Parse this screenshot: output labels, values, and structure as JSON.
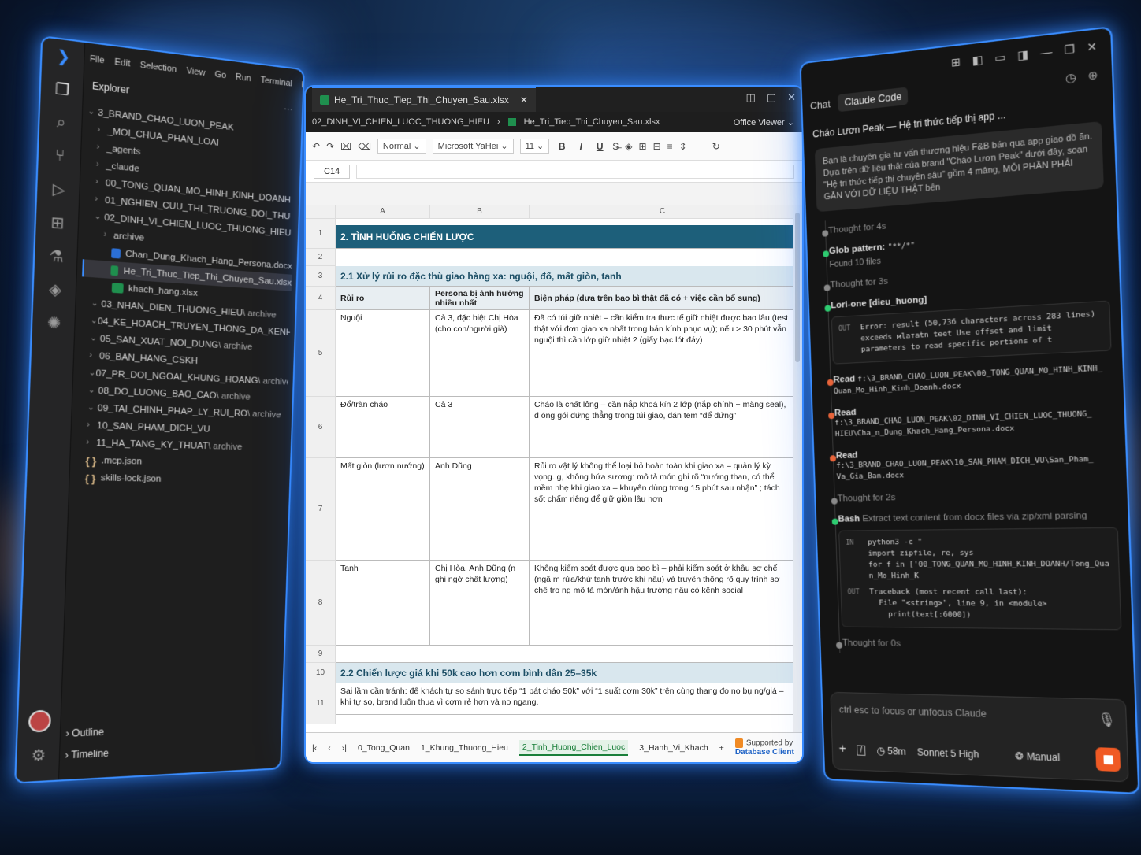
{
  "vscode": {
    "menu": [
      "File",
      "Edit",
      "Selection",
      "View",
      "Go",
      "Run",
      "Terminal",
      "Help"
    ],
    "explorer_title": "Explorer",
    "root": "3_BRAND_CHAO_LUON_PEAK",
    "tree": [
      {
        "chev": "›",
        "name": "_MOI_CHUA_PHAN_LOAI",
        "suffix": "",
        "type": "folder",
        "indent": 1
      },
      {
        "chev": "›",
        "name": "_agents",
        "suffix": "",
        "type": "folder",
        "indent": 1
      },
      {
        "chev": "›",
        "name": "_claude",
        "suffix": "",
        "type": "folder",
        "indent": 1
      },
      {
        "chev": "›",
        "name": "00_TONG_QUAN_MO_HINH_KINH_DOANH",
        "suffix": "",
        "type": "folder",
        "indent": 1
      },
      {
        "chev": "›",
        "name": "01_NGHIEN_CUU_THI_TRUONG_DOI_THU",
        "suffix": "",
        "type": "folder",
        "indent": 1
      },
      {
        "chev": "⌄",
        "name": "02_DINH_VI_CHIEN_LUOC_THUONG_HIEU",
        "suffix": "",
        "type": "folder",
        "indent": 1
      },
      {
        "chev": "›",
        "name": "archive",
        "suffix": "",
        "type": "folder",
        "indent": 2
      },
      {
        "chev": "",
        "name": "Chan_Dung_Khach_Hang_Persona.docx",
        "suffix": "",
        "type": "docx",
        "indent": 2
      },
      {
        "chev": "",
        "name": "He_Tri_Thuc_Tiep_Thi_Chuyen_Sau.xlsx",
        "suffix": "",
        "type": "xlsx",
        "indent": 2,
        "selected": true
      },
      {
        "chev": "",
        "name": "khach_hang.xlsx",
        "suffix": "",
        "type": "xlsx",
        "indent": 2
      },
      {
        "chev": "⌄",
        "name": "03_NHAN_DIEN_THUONG_HIEU",
        "suffix": " \\ archive",
        "type": "folder",
        "indent": 1
      },
      {
        "chev": "⌄",
        "name": "04_KE_HOACH_TRUYEN_THONG_DA_KENH",
        "suffix": " \\ archive",
        "type": "folder",
        "indent": 1
      },
      {
        "chev": "⌄",
        "name": "05_SAN_XUAT_NOI_DUNG",
        "suffix": " \\ archive",
        "type": "folder",
        "indent": 1
      },
      {
        "chev": "›",
        "name": "06_BAN_HANG_CSKH",
        "suffix": "",
        "type": "folder",
        "indent": 1
      },
      {
        "chev": "⌄",
        "name": "07_PR_DOI_NGOAI_KHUNG_HOANG",
        "suffix": " \\ archive",
        "type": "folder",
        "indent": 1
      },
      {
        "chev": "⌄",
        "name": "08_DO_LUONG_BAO_CAO",
        "suffix": " \\ archive",
        "type": "folder",
        "indent": 1
      },
      {
        "chev": "⌄",
        "name": "09_TAI_CHINH_PHAP_LY_RUI_RO",
        "suffix": " \\ archive",
        "type": "folder",
        "indent": 1
      },
      {
        "chev": "›",
        "name": "10_SAN_PHAM_DICH_VU",
        "suffix": "",
        "type": "folder",
        "indent": 1
      },
      {
        "chev": "›",
        "name": "11_HA_TANG_KY_THUAT",
        "suffix": " \\ archive",
        "type": "folder",
        "indent": 1
      },
      {
        "chev": "",
        "name": ".mcp.json",
        "suffix": "",
        "type": "json",
        "indent": 0
      },
      {
        "chev": "",
        "name": "skills-lock.json",
        "suffix": "",
        "type": "json",
        "indent": 0
      }
    ],
    "outline": "Outline",
    "timeline": "Timeline"
  },
  "office": {
    "tab_title": "He_Tri_Thuc_Tiep_Thi_Chuyen_Sau.xlsx",
    "breadcrumb_folder": "02_DINH_VI_CHIEN_LUOC_THUONG_HIEU",
    "breadcrumb_file": "He_Tri_Tiep_Thi_Chuyen_Sau.xlsx",
    "viewer_label": "Office Viewer",
    "style_value": "Normal",
    "font_value": "Microsoft YaHei",
    "size_value": "11",
    "cell_ref": "C14",
    "columns": [
      "A",
      "B",
      "C"
    ],
    "rows": {
      "r1": "2. TÌNH HUỐNG CHIẾN LƯỢC",
      "r3": "2.1 Xử lý rủi ro đặc thù giao hàng xa: nguội, đổ, mất giòn, tanh",
      "h_a": "Rủi ro",
      "h_b": "Persona bị ảnh hưởng nhiều nhất",
      "h_c": "Biện pháp (dựa trên bao bì thật đã có + việc cần bổ sung)",
      "r5a": "Nguội",
      "r5b": "Cả 3, đặc biệt Chị Hòa (cho con/người già)",
      "r5c": "Đã có túi giữ nhiệt – cần kiểm tra thực tế giữ nhiệt được bao lâu (test thật với đơn giao xa nhất trong bán kính phục vụ); nếu > 30 phút vẫn nguội thì cần lớp giữ nhiệt 2 (giấy bạc lót đáy)",
      "r6a": "Đổ/tràn cháo",
      "r6b": "Cả 3",
      "r6c": "Cháo là chất lỏng – cần nắp khoá kín 2 lớp (nắp chính + màng seal), đ óng gói đứng thẳng trong túi giao, dán tem “để đứng”",
      "r7a": "Mất giòn (lươn nướng)",
      "r7b": "Anh Dũng",
      "r7c": "Rủi ro vật lý không thể loại bỏ hoàn toàn khi giao xa – quản lý kỳ vọng. g, không hứa sương: mô tả món ghi rõ “nướng than, có thể mềm nhẹ khi giao xa – khuyên dùng trong 15 phút sau nhận” ; tách sốt chấm riêng để giữ giòn lâu hơn",
      "r8a": "Tanh",
      "r8b": "Chị Hòa, Anh Dũng (n ghi ngờ chất lượng)",
      "r8c": "Không kiểm soát được qua bao bì – phải kiểm soát ở khâu sơ chế (ngâ m rửa/khử tanh trước khi nấu) và truyền thông rõ quy trình sơ chế tro ng mô tả món/ảnh hậu trường nấu có kênh social",
      "r10": "2.2 Chiến lược giá khi 50k cao hơn cơm bình dân 25–35k",
      "r11": "Sai lầm cần tránh: để khách tự so sánh trực tiếp  “1 bát cháo 50k”  với  “1 suất cơm 30k”  trên cùng thang đo no bụ ng/giá – khi tự so, brand luôn thua vì cơm rẻ hơn và no ngang."
    },
    "row_numbers": [
      "1",
      "2",
      "3",
      "4",
      "5",
      "6",
      "7",
      "8",
      "9",
      "10",
      "11"
    ],
    "sheets": [
      "0_Tong_Quan",
      "1_Khung_Thuong_Hieu",
      "2_Tinh_Huong_Chien_Luoc",
      "3_Hanh_Vi_Khach"
    ],
    "supported_by": "Supported by",
    "supported_brand": "Database Client"
  },
  "claude": {
    "tab_chat": "Chat",
    "tab_code": "Claude Code",
    "session_title": "Cháo Lươn Peak — Hệ tri thức tiếp thị app ...",
    "prompt": "Bạn là chuyên gia tư vấn thương hiệu F&B bán qua app giao đồ ăn. Dựa trên dữ liệu thật của brand \"Cháo Lươn Peak\" dưới đây, soạn \"Hệ tri thức tiếp thị chuyên sâu\" gồm 4 mảng, MỖI PHẦN PHẢI GẮN VỚI DỮ LIỆU THẬT bên",
    "events": {
      "t1": "Thought for 4s",
      "glob_label": "Glob pattern:",
      "glob_value": "\"**/*\"",
      "glob_sub": "Found 10 files",
      "t2": "Thought for 3s",
      "lori": "Lori-one [dieu_huong]",
      "out_label": "OUT",
      "err": "Error: result (50,736 characters across 283 lines) exceeds мlатаtn tеet Use offset and limit parameters to read specific portions of t",
      "read_label": "Read",
      "read1": "f:\\3_BRAND_CHAO_LUON_PEAK\\00_TONG_QUAN_MO_HINH_KINH_ Quan_Mo_Hinh_Kinh_Doanh.docx",
      "read2": "f:\\3_BRAND_CHAO_LUON_PEAK\\02_DINH_VI_CHIEN_LUOC_THUONG_ HIEU\\Cha_n_Dung_Khach_Hang_Persona.docx",
      "read3": "f:\\3_BRAND_CHAO_LUON_PEAK\\10_SAN_PHAM_DICH_VU\\San_Pham_ Va_Gia_Ban.docx",
      "t3": "Thought for 2s",
      "bash_label": "Bash",
      "bash_desc": "Extract text content from docx files via zip/xml parsing",
      "in_label": "IN",
      "code_in": "python3 -c \"\nimport zipfile, re, sys\nfor f in ['00_TONG_QUAN_MO_HINH_KINH_DOANH/Tong_Quan_Mo_Hinh_K",
      "code_out": "Traceback (most recent call last):\n  File \"<string>\", line 9, in <module>\n    print(text[:6000])",
      "t4": "Thought for 0s"
    },
    "input_placeholder": "ctrl esc to focus or unfocus Claude",
    "timer": "58m",
    "model": "Sonnet 5 High",
    "mode": "Manual"
  }
}
